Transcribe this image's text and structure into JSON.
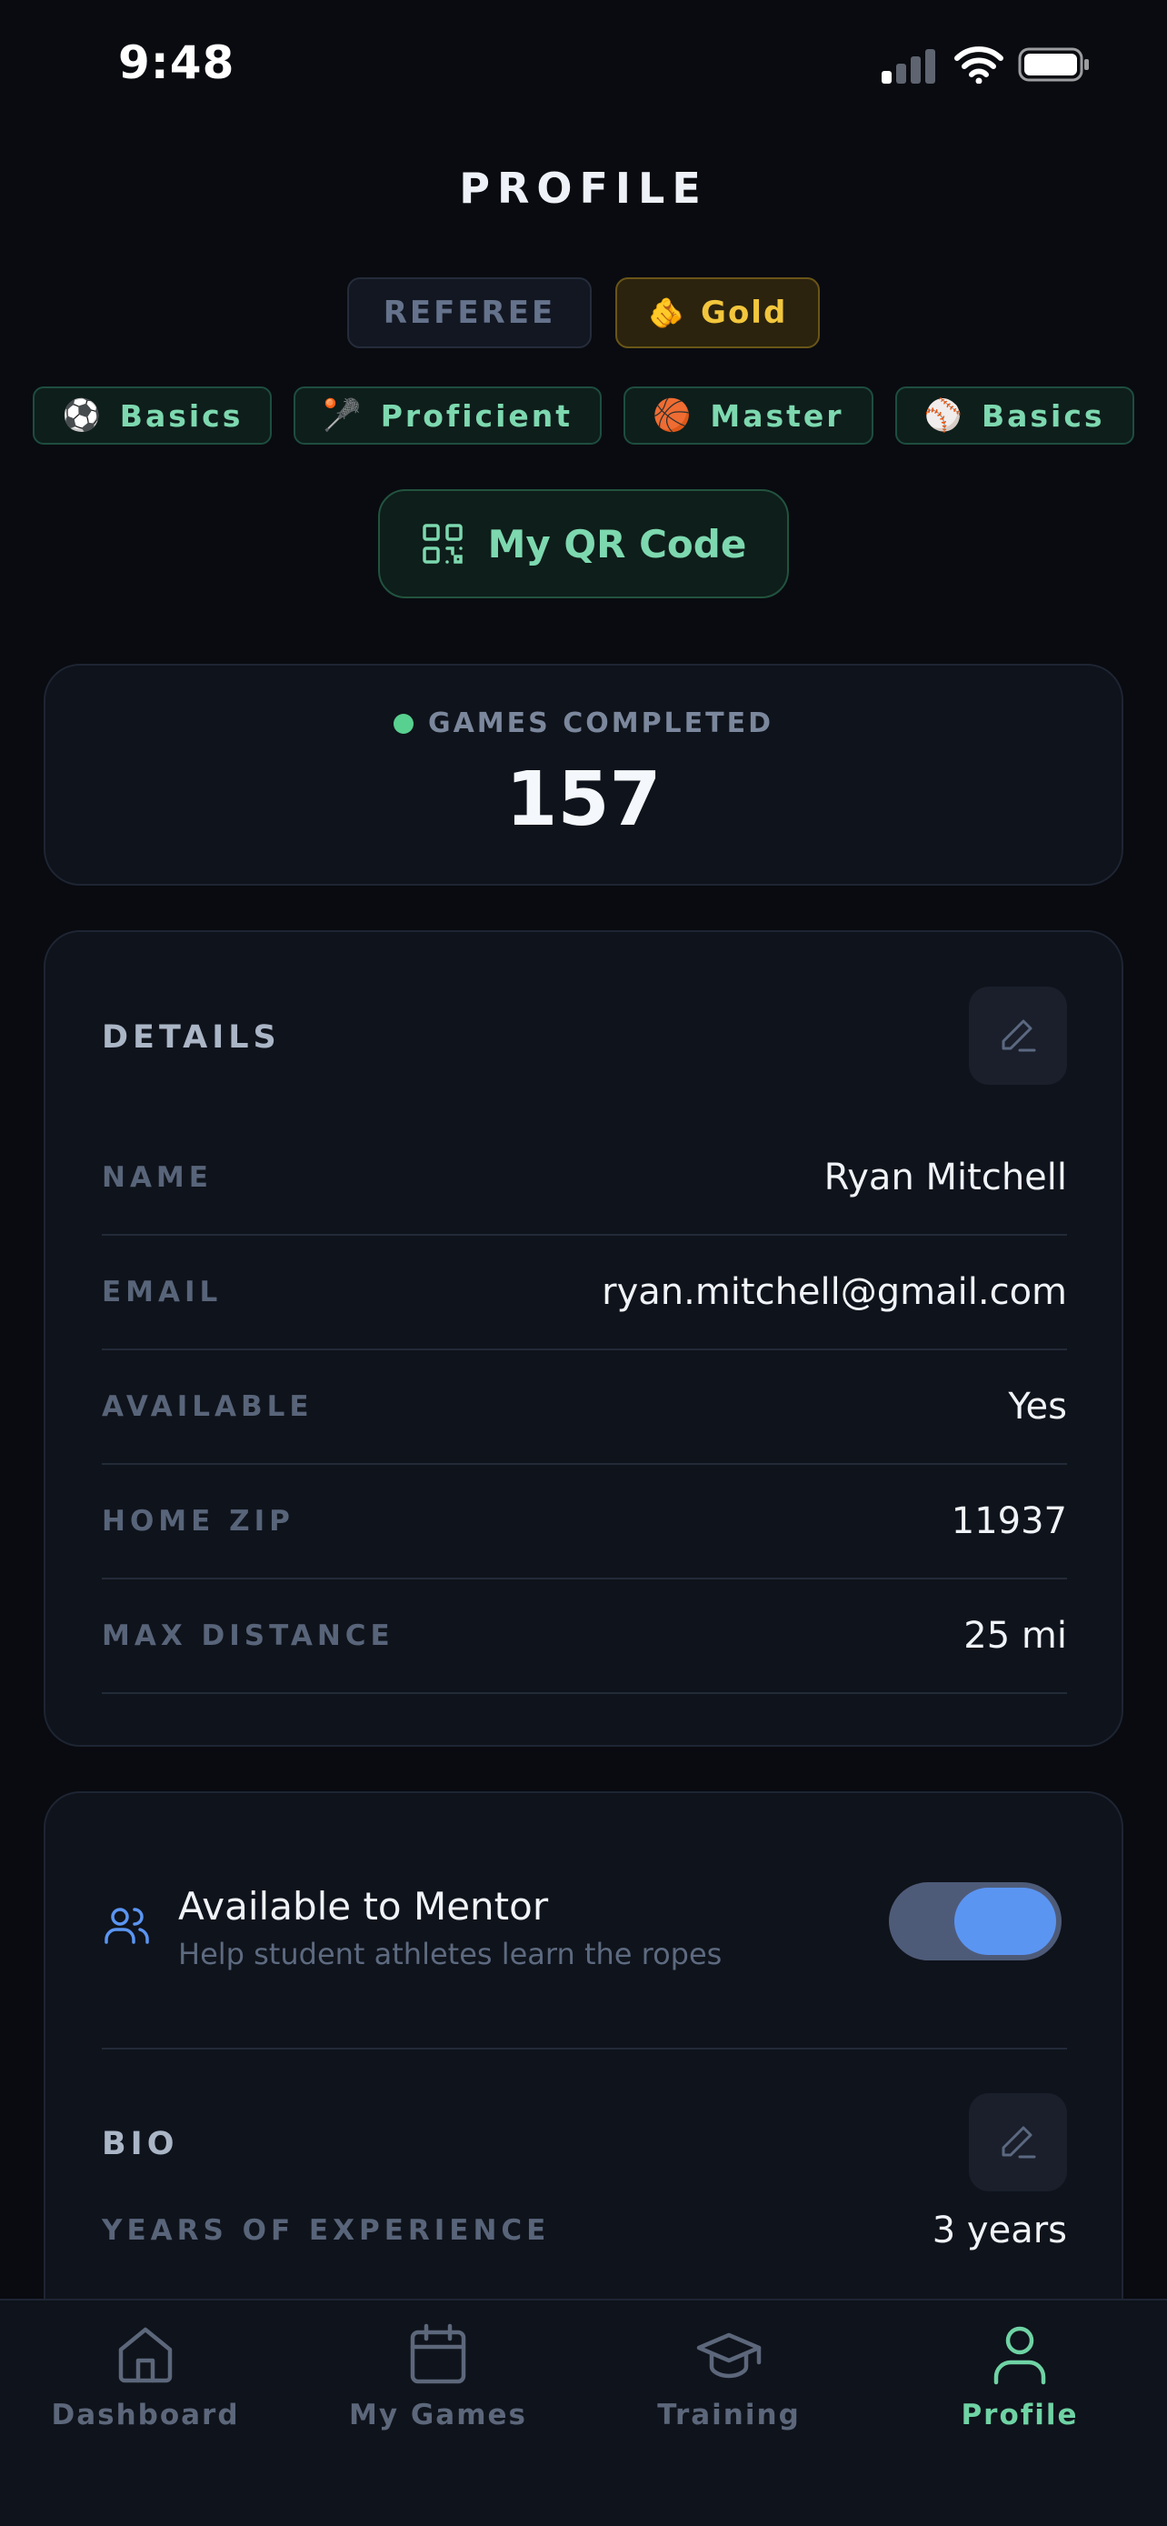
{
  "status_bar": {
    "time": "9:48"
  },
  "header": {
    "title": "PROFILE"
  },
  "roles": {
    "referee": "REFEREE",
    "tier": "Gold",
    "tier_emoji": "🫵"
  },
  "sports": [
    {
      "emoji": "⚽",
      "label": "Basics"
    },
    {
      "emoji": "🥍",
      "label": "Proficient"
    },
    {
      "emoji": "🏀",
      "label": "Master"
    },
    {
      "emoji": "⚾",
      "label": "Basics"
    }
  ],
  "qr_button": {
    "label": "My QR Code"
  },
  "games": {
    "label": "GAMES COMPLETED",
    "value": "157"
  },
  "details": {
    "title": "DETAILS",
    "rows": [
      {
        "label": "NAME",
        "value": "Ryan Mitchell"
      },
      {
        "label": "EMAIL",
        "value": "ryan.mitchell@gmail.com"
      },
      {
        "label": "AVAILABLE",
        "value": "Yes"
      },
      {
        "label": "HOME ZIP",
        "value": "11937"
      },
      {
        "label": "MAX DISTANCE",
        "value": "25 mi"
      }
    ]
  },
  "mentor": {
    "title": "Available to Mentor",
    "subtitle": "Help student athletes learn the ropes",
    "enabled": true
  },
  "bio": {
    "title": "BIO",
    "rows": [
      {
        "label": "YEARS OF EXPERIENCE",
        "value": "3 years"
      }
    ]
  },
  "tabs": [
    {
      "label": "Dashboard",
      "icon": "home-icon",
      "active": false
    },
    {
      "label": "My Games",
      "icon": "calendar-icon",
      "active": false
    },
    {
      "label": "Training",
      "icon": "graduation-cap-icon",
      "active": false
    },
    {
      "label": "Profile",
      "icon": "user-icon",
      "active": true
    }
  ],
  "colors": {
    "background": "#090b10",
    "card": "#0f131b",
    "accent_green": "#7dd8af",
    "gold": "#f2c63d",
    "toggle_blue": "#5b95f2"
  }
}
